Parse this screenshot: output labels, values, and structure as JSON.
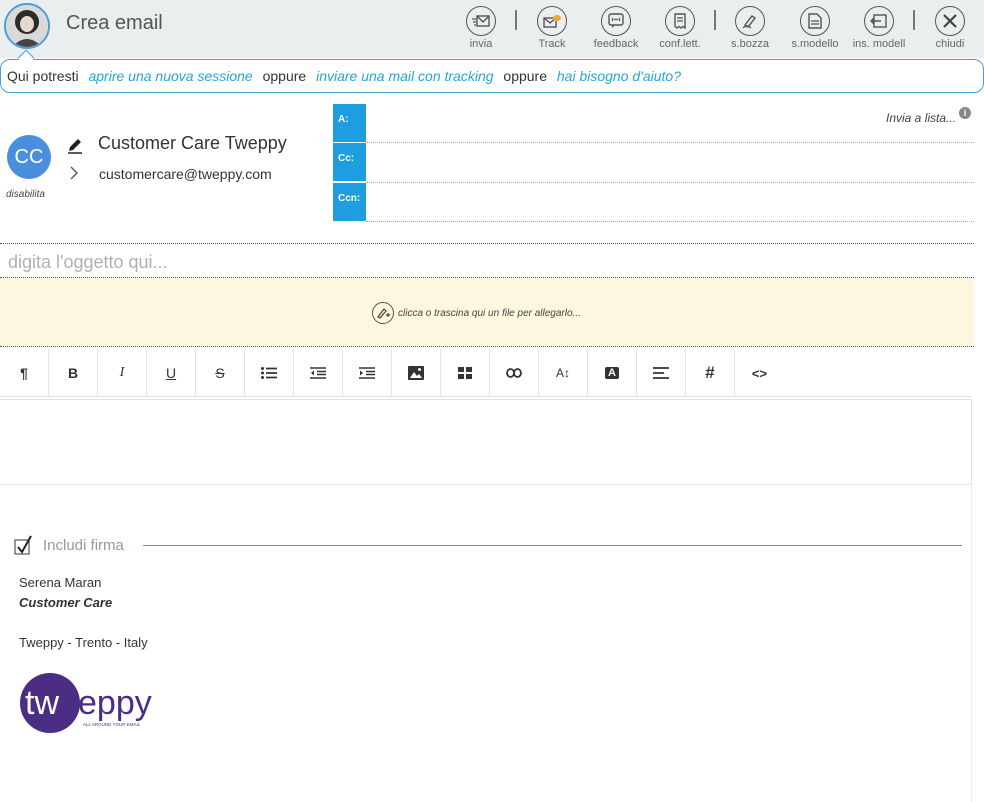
{
  "header": {
    "title": "Crea email",
    "toolbar": [
      {
        "id": "invia",
        "label": "invia",
        "icon": "send-icon"
      },
      {
        "id": "track",
        "label": "Track",
        "icon": "track-icon"
      },
      {
        "id": "feedback",
        "label": "feedback",
        "icon": "feedback-icon"
      },
      {
        "id": "conf",
        "label": "conf.lett.",
        "icon": "read-receipt-icon"
      },
      {
        "id": "sbozza",
        "label": "s.bozza",
        "icon": "save-draft-icon"
      },
      {
        "id": "smodello",
        "label": "s.modello",
        "icon": "save-template-icon"
      },
      {
        "id": "insmodell",
        "label": "ins. modell",
        "icon": "insert-template-icon"
      },
      {
        "id": "chiudi",
        "label": "chiudi",
        "icon": "close-icon"
      }
    ]
  },
  "suggestion": {
    "prefix": "Qui potresti",
    "link1": "aprire una nuova sessione",
    "sep1": "oppure",
    "link2": "inviare una mail con tracking",
    "sep2": "oppure",
    "link3": "hai bisogno d'aiuto?"
  },
  "sender": {
    "initials": "CC",
    "status": "disabilita",
    "name": "Customer Care Tweppy",
    "email": "customercare@tweppy.com"
  },
  "recipients": {
    "to_label": "A:",
    "cc_label": "Cc:",
    "bcc_label": "Ccn:",
    "to_value": "",
    "cc_value": "",
    "bcc_value": "",
    "send_to_list": "Invia a lista..."
  },
  "subject": {
    "placeholder": "digita l'oggetto qui...",
    "value": ""
  },
  "attachment": {
    "text": "clicca o trascina qui un file per allegarlo..."
  },
  "editor_toolbar": [
    {
      "name": "paragraph",
      "glyph": "¶"
    },
    {
      "name": "bold",
      "glyph": "B"
    },
    {
      "name": "italic",
      "glyph": "I"
    },
    {
      "name": "underline",
      "glyph": "U"
    },
    {
      "name": "strikethrough",
      "glyph": "S"
    },
    {
      "name": "bullet-list"
    },
    {
      "name": "outdent"
    },
    {
      "name": "indent"
    },
    {
      "name": "image"
    },
    {
      "name": "table"
    },
    {
      "name": "link"
    },
    {
      "name": "font-size",
      "glyph": "A↕"
    },
    {
      "name": "text-color",
      "glyph": "A"
    },
    {
      "name": "align"
    },
    {
      "name": "hashtag",
      "glyph": "#"
    },
    {
      "name": "code",
      "glyph": "<>"
    }
  ],
  "signature": {
    "label": "Includi firma",
    "checked": true,
    "name": "Serena Maran",
    "role": "Customer Care",
    "company_line": "Tweppy - Trento - Italy",
    "logo_text": "tweppy",
    "logo_tagline": "ALL AROUND YOUR EMAIL",
    "colors": {
      "logo_purple": "#4b2e83",
      "accent_blue": "#1e9de0"
    }
  }
}
